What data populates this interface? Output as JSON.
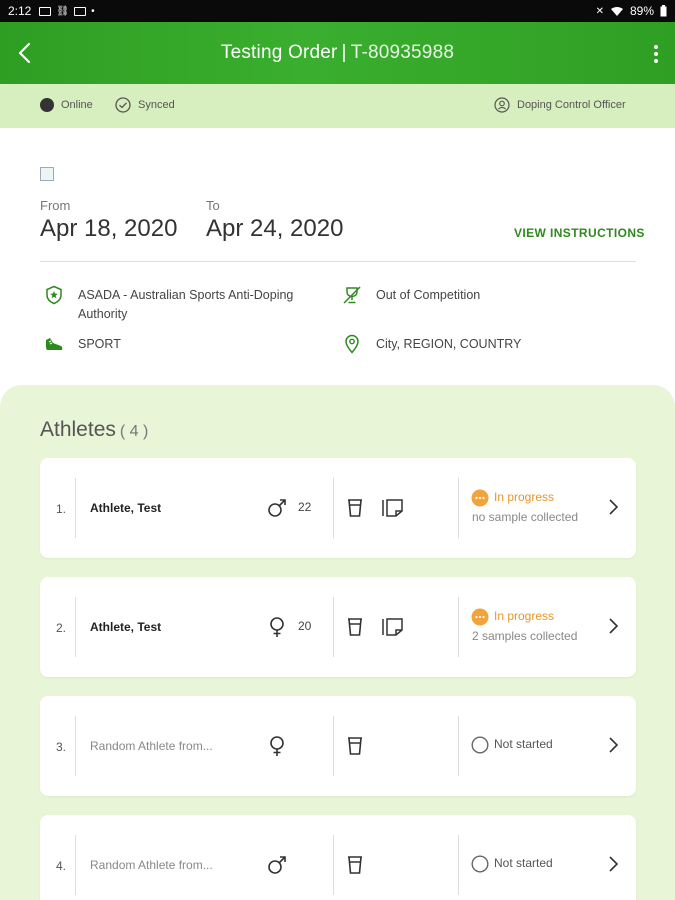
{
  "status_bar": {
    "time": "2:12",
    "battery": "89%"
  },
  "app_bar": {
    "title": "Testing Order",
    "separator": "|",
    "order_code": "T-80935988"
  },
  "connection": {
    "online": "Online",
    "synced": "Synced",
    "role": "Doping Control Officer"
  },
  "order": {
    "from_label": "From",
    "from_date": "Apr 18, 2020",
    "to_label": "To",
    "to_date": "Apr 24, 2020",
    "view_instructions": "VIEW INSTRUCTIONS",
    "authority": "ASADA - Australian Sports Anti-Doping Authority",
    "authority_line1": "ASADA - Australian Sports Anti-Doping",
    "authority_line2": "Authority",
    "competition": "Out of Competition",
    "sport": "SPORT",
    "location": "City, REGION, COUNTRY"
  },
  "athletes": {
    "title": "Athletes",
    "count": "( 4 )",
    "items": [
      {
        "num": "1.",
        "name": "Athlete, Test",
        "gender_icon": "male-icon",
        "age": "22",
        "status": "In progress",
        "sub": "no sample collected"
      },
      {
        "num": "2.",
        "name": "Athlete, Test",
        "gender_icon": "female-icon",
        "age": "20",
        "status": "In progress",
        "sub": "2 samples collected"
      },
      {
        "num": "3.",
        "name": "Random Athlete from...",
        "gender_icon": "female-icon",
        "age": "",
        "status": "Not started",
        "sub": ""
      },
      {
        "num": "4.",
        "name": "Random Athlete from...",
        "gender_icon": "male-icon",
        "age": "",
        "status": "Not started",
        "sub": ""
      }
    ]
  },
  "colors": {
    "app_bar": "#3aae2e",
    "status_strip": "#d7efbf",
    "athletes_bg": "#e8f5d6",
    "in_progress": "#e6962b",
    "accent": "#2e8a1f"
  }
}
